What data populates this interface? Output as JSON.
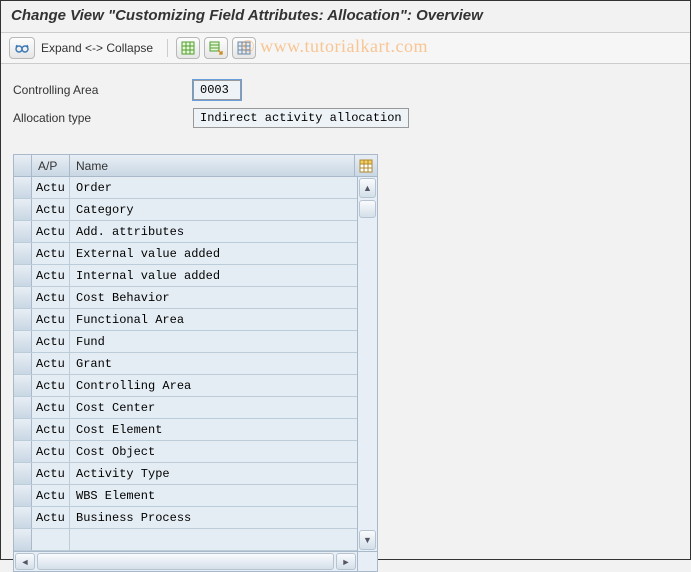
{
  "title": "Change View \"Customizing Field Attributes: Allocation\": Overview",
  "watermark": "© www.tutorialkart.com",
  "toolbar": {
    "expand_collapse_label": "Expand <-> Collapse"
  },
  "form": {
    "controlling_area_label": "Controlling Area",
    "controlling_area_value": "0003",
    "allocation_type_label": "Allocation type",
    "allocation_type_value": "Indirect activity allocation"
  },
  "grid": {
    "col_ap": "A/P",
    "col_name": "Name",
    "rows": [
      {
        "ap": "Actu",
        "name": "Order"
      },
      {
        "ap": "Actu",
        "name": "Category"
      },
      {
        "ap": "Actu",
        "name": "Add. attributes"
      },
      {
        "ap": "Actu",
        "name": "External value added"
      },
      {
        "ap": "Actu",
        "name": "Internal value added"
      },
      {
        "ap": "Actu",
        "name": "Cost Behavior"
      },
      {
        "ap": "Actu",
        "name": "Functional Area"
      },
      {
        "ap": "Actu",
        "name": "Fund"
      },
      {
        "ap": "Actu",
        "name": "Grant"
      },
      {
        "ap": "Actu",
        "name": "Controlling Area"
      },
      {
        "ap": "Actu",
        "name": "Cost Center"
      },
      {
        "ap": "Actu",
        "name": "Cost Element"
      },
      {
        "ap": "Actu",
        "name": "Cost Object"
      },
      {
        "ap": "Actu",
        "name": "Activity Type"
      },
      {
        "ap": "Actu",
        "name": "WBS Element"
      },
      {
        "ap": "Actu",
        "name": "Business Process"
      }
    ]
  }
}
